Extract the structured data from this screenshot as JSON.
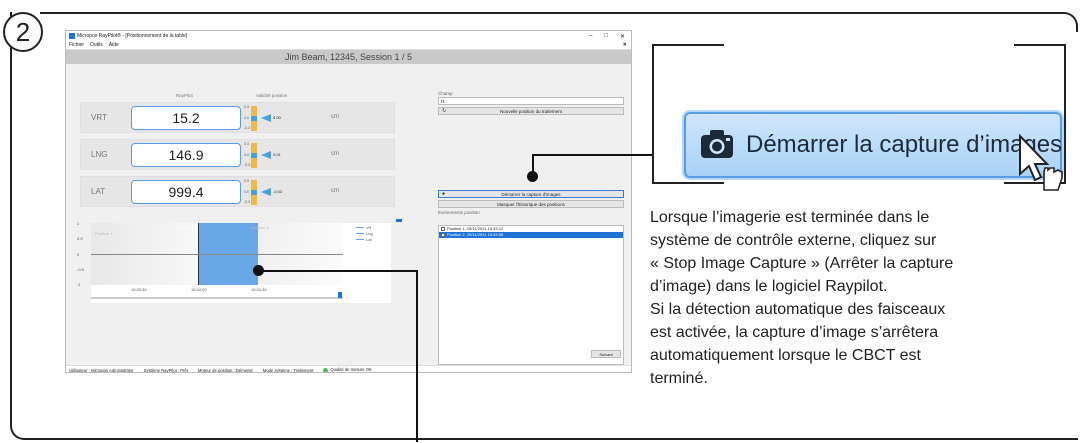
{
  "step": {
    "number": "2"
  },
  "window": {
    "title": "Micropos RayPilot® - [Positionnement de la table]",
    "menu": [
      "Fichier",
      "Outils",
      "Aide"
    ],
    "patient_header": "Jim Beam, 12345, Session 1 / 5"
  },
  "positions": {
    "col_raypilot": "RayPilot",
    "col_validity": "Validité position",
    "rows": [
      {
        "axis": "VRT",
        "value": "15.2",
        "gauge_top": "0.3",
        "gauge_mid": "0.0",
        "gauge_bottom": "-0.3",
        "offset": "0.00",
        "unit": "cm"
      },
      {
        "axis": "LNG",
        "value": "146.9",
        "gauge_top": "0.3",
        "gauge_mid": "0.0",
        "gauge_bottom": "-0.3",
        "offset": "0.01",
        "unit": "cm"
      },
      {
        "axis": "LAT",
        "value": "999.4",
        "gauge_top": "0.3",
        "gauge_mid": "0.0",
        "gauge_bottom": "-0.3",
        "offset": "-0.03",
        "unit": "cm"
      }
    ]
  },
  "chart_data": {
    "type": "line",
    "y_ticks": [
      "1",
      "0.5",
      "0",
      "-0.5",
      "-1"
    ],
    "x_ticks": [
      "15:33:30",
      "15:34:00",
      "15:34:30"
    ],
    "region_labels": [
      "Position 1",
      "Position 2",
      "Position 3"
    ],
    "series": [
      {
        "name": "Vrt"
      },
      {
        "name": "Lng"
      },
      {
        "name": "Lat"
      }
    ]
  },
  "right_panel": {
    "field_label": "Champ",
    "field_value": "f1",
    "new_position_button": "Nouvelle position du traitement",
    "capture_button": "Démarrer la capture d'images",
    "hide_history_button": "Masquer l'historique des positions",
    "events_label": "Événements position",
    "events": [
      {
        "text": "Position 1, 25/11/2021 15:33:12",
        "selected": false
      },
      {
        "text": "Position 2, 25/11/2021 15:33:58",
        "selected": true
      }
    ],
    "next_button": "Suivant"
  },
  "status_bar": [
    "Utilisateur : Micropos Administrator",
    "Système RayPilot : Prêt",
    "Moteur de position : Démenté",
    "Mode système : Traitement",
    "Qualité de mesure OK"
  ],
  "zoom_callout": {
    "button_label": "Démarrer la capture d’images",
    "icon": "camera-icon"
  },
  "instructions": {
    "p1": "Lorsque l’imagerie est terminée dans le\nsystème de contrôle externe, cliquez sur\n« Stop Image Capture » (Arrêter la capture\nd’image) dans le logiciel Raypilot.",
    "p2": "Si la détection automatique des faisceaux\nest activée, la capture d’image s’arrêtera\nautomatiquement lorsque le CBCT est\nterminé."
  }
}
